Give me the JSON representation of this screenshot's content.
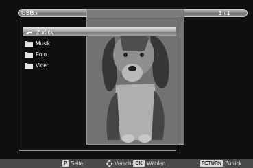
{
  "path_bar": {
    "path": "USB:\\",
    "counter": "1 \\ 1"
  },
  "list": {
    "items": [
      {
        "label": "Zurück",
        "icon": "back-arrow-icon",
        "selected": true
      },
      {
        "label": "Musik",
        "icon": "folder-icon",
        "selected": false
      },
      {
        "label": "Foto",
        "icon": "folder-icon",
        "selected": false
      },
      {
        "label": "Video",
        "icon": "folder-icon",
        "selected": false
      }
    ]
  },
  "preview": {
    "subject": "dog-photo-thumbnail"
  },
  "help": {
    "p_key": "P",
    "p_text": "Seite",
    "move_text": "Verschieben",
    "ok_key": "OK",
    "ok_text": "Wählen",
    "return_key": "RETURN",
    "return_text": "Zurück"
  },
  "colors": {
    "background": "#0f0f0f",
    "bar": "#8a8a8a",
    "helpbar": "#4a4a4a",
    "highlight": "#a0a0a0"
  }
}
